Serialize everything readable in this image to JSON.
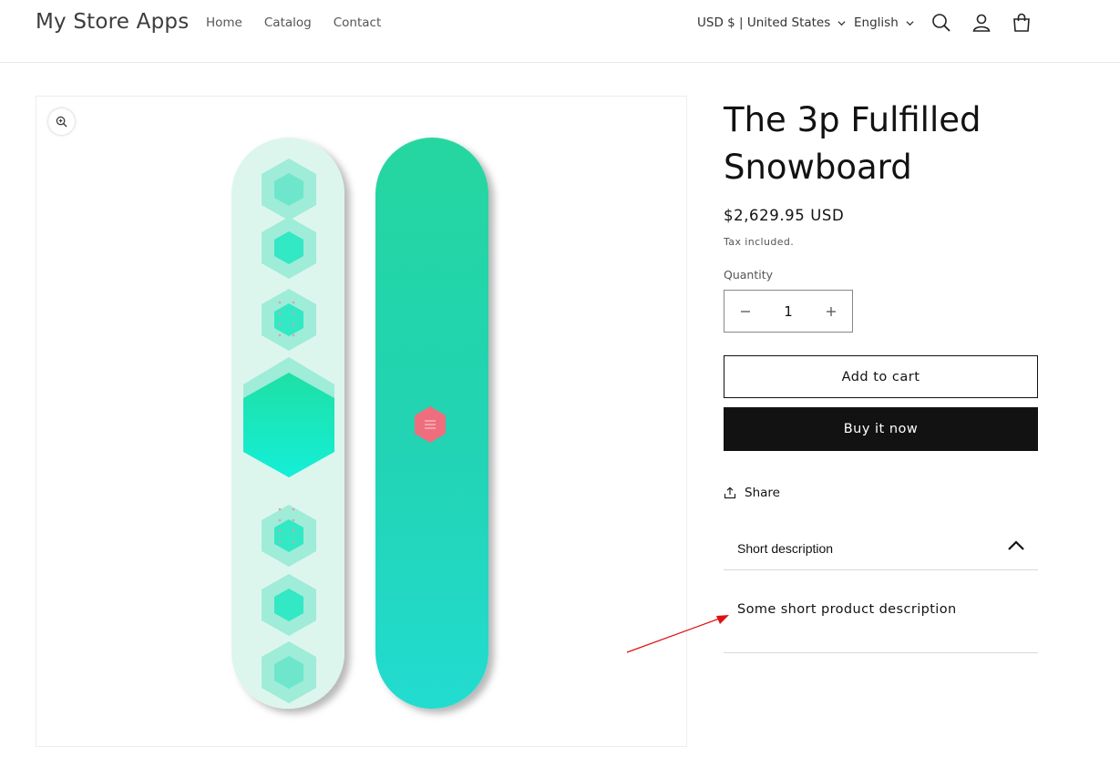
{
  "store": {
    "name": "My Store Apps"
  },
  "nav": {
    "items": [
      "Home",
      "Catalog",
      "Contact"
    ]
  },
  "header": {
    "currency": "USD $ | United States",
    "language": "English"
  },
  "product": {
    "title": "The 3p Fulfilled Snowboard",
    "price": "$2,629.95 USD",
    "tax_note": "Tax included.",
    "quantity_label": "Quantity",
    "quantity": "1",
    "add_to_cart": "Add to cart",
    "buy_now": "Buy it now",
    "share": "Share"
  },
  "accordion": {
    "title": "Short description",
    "body": "Some short product description",
    "expanded": true
  },
  "colors": {
    "primary": "#121212",
    "board_teal": "#1fd6a6",
    "arrow": "#e01010"
  }
}
